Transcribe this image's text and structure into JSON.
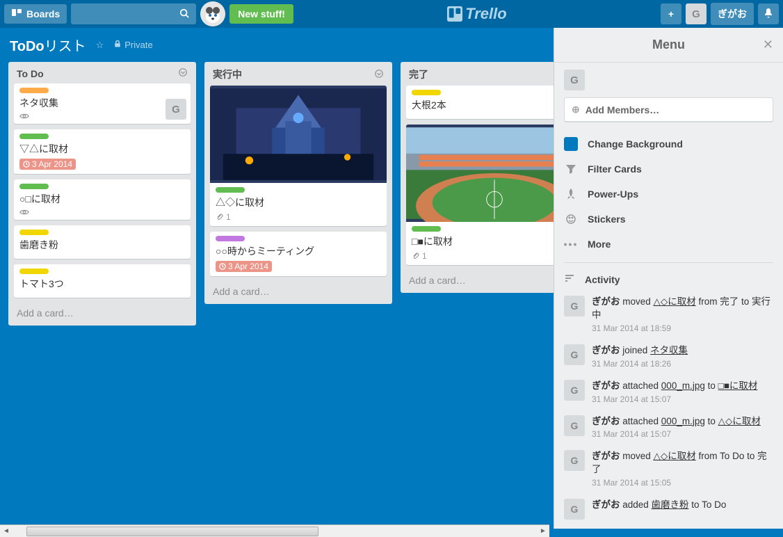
{
  "header": {
    "boards_label": "Boards",
    "new_stuff_label": "New stuff!",
    "logo_text": "Trello",
    "user_initial": "G",
    "user_name": "ぎがお"
  },
  "board": {
    "title_bold": "ToDo",
    "title_rest": "リスト",
    "privacy_label": "Private"
  },
  "lists": [
    {
      "name": "To Do",
      "cards": [
        {
          "labels": [
            "orange"
          ],
          "title": "ネタ収集",
          "watch": true,
          "member": "G"
        },
        {
          "labels": [
            "green"
          ],
          "title": "▽△に取材",
          "due": "3 Apr 2014"
        },
        {
          "labels": [
            "green"
          ],
          "title": "○□に取材",
          "watch": true
        },
        {
          "labels": [
            "yellow"
          ],
          "title": "歯磨き粉"
        },
        {
          "labels": [
            "yellow"
          ],
          "title": "トマト3つ"
        }
      ],
      "add_label": "Add a card…"
    },
    {
      "name": "実行中",
      "cards": [
        {
          "cover": "robot",
          "labels": [
            "green"
          ],
          "title": "△◇に取材",
          "attach": "1"
        },
        {
          "labels": [
            "purple"
          ],
          "title": "○○時からミーティング",
          "due": "3 Apr 2014"
        }
      ],
      "add_label": "Add a card…"
    },
    {
      "name": "完了",
      "cards": [
        {
          "labels": [
            "yellow"
          ],
          "title": "大根2本"
        },
        {
          "cover": "stadium",
          "labels": [
            "green"
          ],
          "title": "□■に取材",
          "attach": "1"
        }
      ],
      "add_label": "Add a card…"
    }
  ],
  "menu": {
    "title": "Menu",
    "member_initial": "G",
    "add_members_label": "Add Members…",
    "items": {
      "background": "Change Background",
      "filter": "Filter Cards",
      "powerups": "Power-Ups",
      "stickers": "Stickers",
      "more": "More"
    },
    "activity_label": "Activity",
    "activity": [
      {
        "avatar": "G",
        "user": "ぎがお",
        "action_pre": " moved ",
        "link": "△◇に取材",
        "action_post": " from 完了 to 実行中",
        "time": "31 Mar 2014 at 18:59"
      },
      {
        "avatar": "G",
        "user": "ぎがお",
        "action_pre": " joined ",
        "link": "ネタ収集",
        "action_post": "",
        "time": "31 Mar 2014 at 18:26"
      },
      {
        "avatar": "G",
        "user": "ぎがお",
        "action_pre": " attached ",
        "link": "000_m.jpg",
        "action_mid": " to ",
        "link2": "□■に取材",
        "time": "31 Mar 2014 at 15:07"
      },
      {
        "avatar": "G",
        "user": "ぎがお",
        "action_pre": " attached ",
        "link": "000_m.jpg",
        "action_mid": " to ",
        "link2": "△◇に取材",
        "time": "31 Mar 2014 at 15:07"
      },
      {
        "avatar": "G",
        "user": "ぎがお",
        "action_pre": " moved ",
        "link": "△◇に取材",
        "action_post": " from To Do to 完了",
        "time": "31 Mar 2014 at 15:05"
      },
      {
        "avatar": "G",
        "user": "ぎがお",
        "action_pre": " added ",
        "link": "歯磨き粉",
        "action_post": " to To Do",
        "time": ""
      }
    ]
  }
}
